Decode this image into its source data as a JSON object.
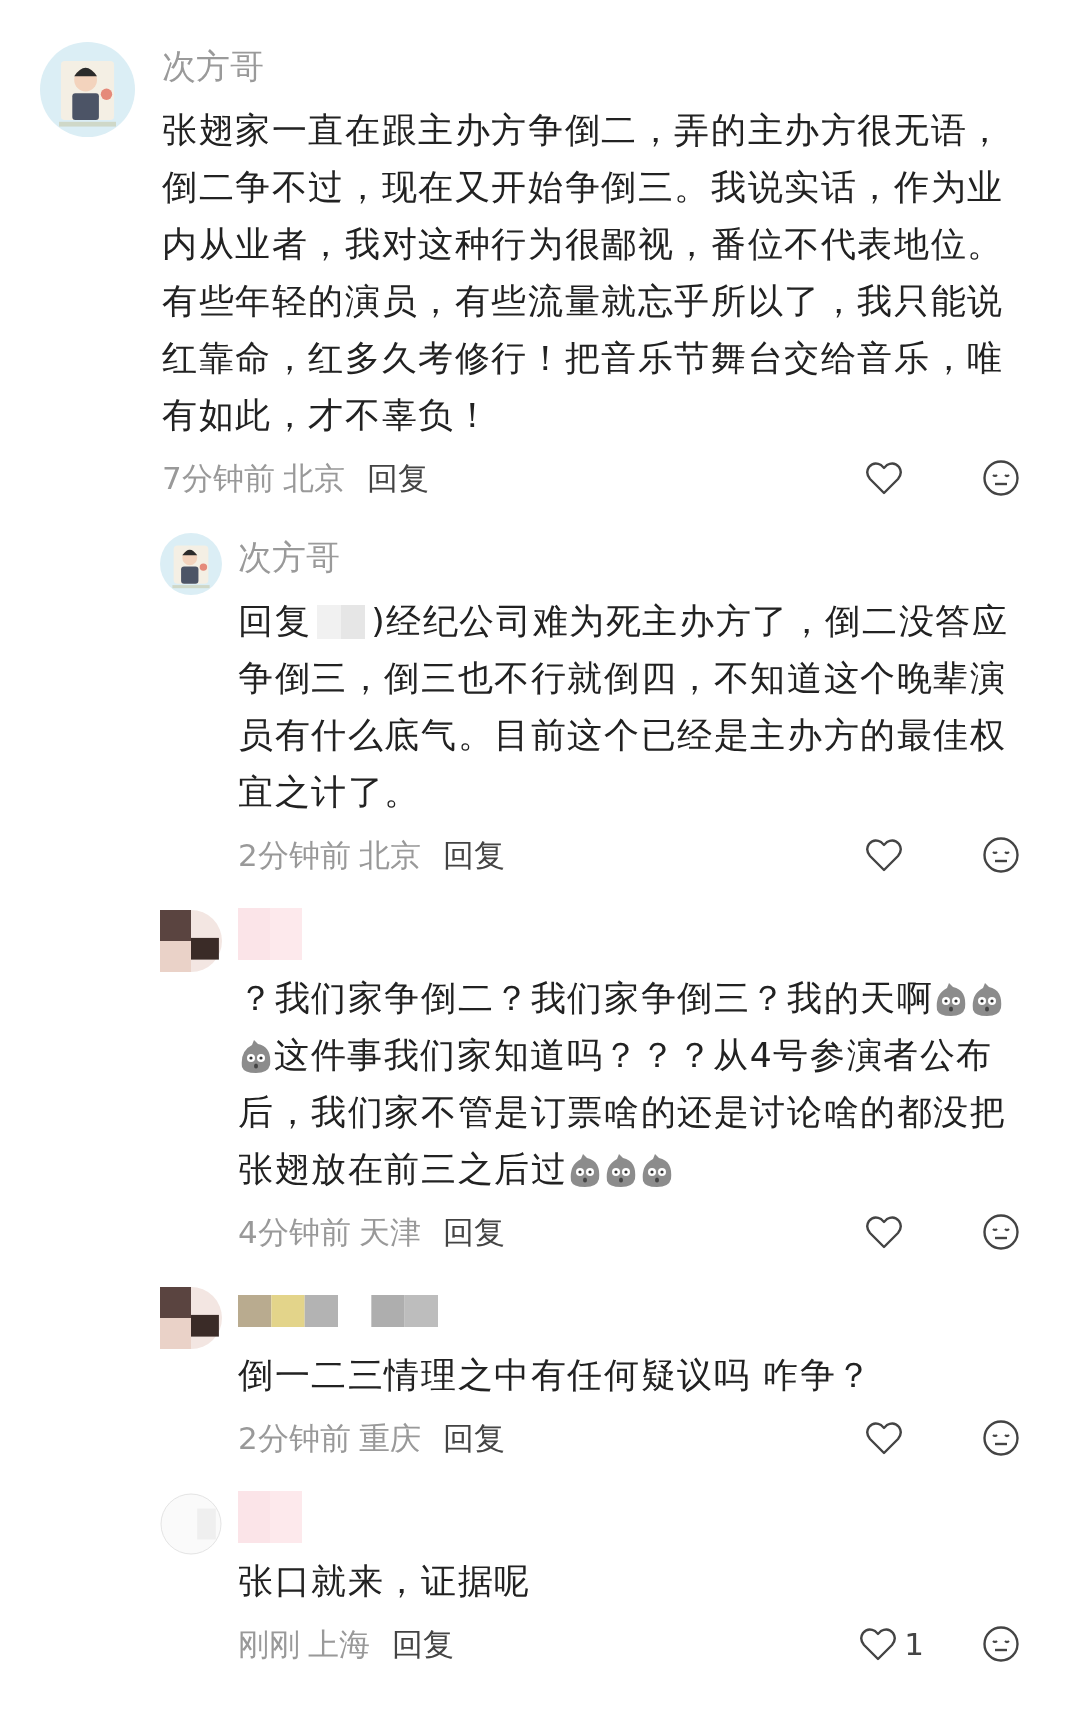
{
  "comments": [
    {
      "kind": "top",
      "avatar": {
        "kind": "cartoon"
      },
      "name": "次方哥",
      "name_censored": false,
      "lines": [
        [
          {
            "kind": "text",
            "text": "张翅家一直在跟主办方争倒二，弄的主办方很无语，"
          }
        ],
        [
          {
            "kind": "text",
            "text": "倒二争不过，现在又开始争倒三。我说实话，作为业"
          }
        ],
        [
          {
            "kind": "text",
            "text": "内从业者，我对这种行为很鄙视，番位不代表地位。"
          }
        ],
        [
          {
            "kind": "text",
            "text": "有些年轻的演员，有些流量就忘乎所以了，我只能说"
          }
        ],
        [
          {
            "kind": "text",
            "text": "红靠命，红多久考修行！把音乐节舞台交给音乐，唯"
          }
        ],
        [
          {
            "kind": "text",
            "text": "有如此，才不辜负！"
          }
        ]
      ],
      "time": "7分钟前",
      "location": "北京",
      "reply_label": "回复"
    },
    {
      "kind": "reply",
      "avatar": {
        "kind": "cartoon"
      },
      "name": "次方哥",
      "name_censored": false,
      "lines": [
        [
          {
            "kind": "text",
            "text": "回复"
          },
          {
            "kind": "mosaic"
          },
          {
            "kind": "text",
            "text": ")经纪公司难为死主办方了，倒二没答应"
          }
        ],
        [
          {
            "kind": "text",
            "text": "争倒三，倒三也不行就倒四，不知道这个晚辈演"
          }
        ],
        [
          {
            "kind": "text",
            "text": "员有什么底气。目前这个已经是主办方的最佳权"
          }
        ],
        [
          {
            "kind": "text",
            "text": "宜之计了。"
          }
        ]
      ],
      "time": "2分钟前",
      "location": "北京",
      "reply_label": "回复"
    },
    {
      "kind": "reply",
      "avatar": {
        "kind": "mosaic"
      },
      "name_censored": true,
      "lines": [
        [
          {
            "kind": "text",
            "text": "？我们家争倒二？我们家争倒三？我的天啊"
          },
          {
            "kind": "emoji"
          },
          {
            "kind": "emoji"
          }
        ],
        [
          {
            "kind": "emoji"
          },
          {
            "kind": "text",
            "text": "这件事我们家知道吗？？？从4号参演者公布"
          }
        ],
        [
          {
            "kind": "text",
            "text": "后，我们家不管是订票啥的还是讨论啥的都没把"
          }
        ],
        [
          {
            "kind": "text",
            "text": "张翅放在前三之后过"
          },
          {
            "kind": "emoji"
          },
          {
            "kind": "emoji"
          },
          {
            "kind": "emoji"
          }
        ]
      ],
      "time": "4分钟前",
      "location": "天津",
      "reply_label": "回复"
    },
    {
      "kind": "reply",
      "avatar": {
        "kind": "mosaic"
      },
      "name_censored": true,
      "lines": [
        [
          {
            "kind": "text",
            "text": "倒一二三情理之中有任何疑议吗 咋争？"
          }
        ]
      ],
      "time": "2分钟前",
      "location": "重庆",
      "reply_label": "回复"
    },
    {
      "kind": "reply",
      "avatar": {
        "kind": "blank"
      },
      "name_censored": true,
      "lines": [
        [
          {
            "kind": "text",
            "text": "张口就来，证据呢"
          }
        ]
      ],
      "time": "刚刚",
      "location": "上海",
      "reply_label": "回复",
      "likes": "1"
    }
  ]
}
